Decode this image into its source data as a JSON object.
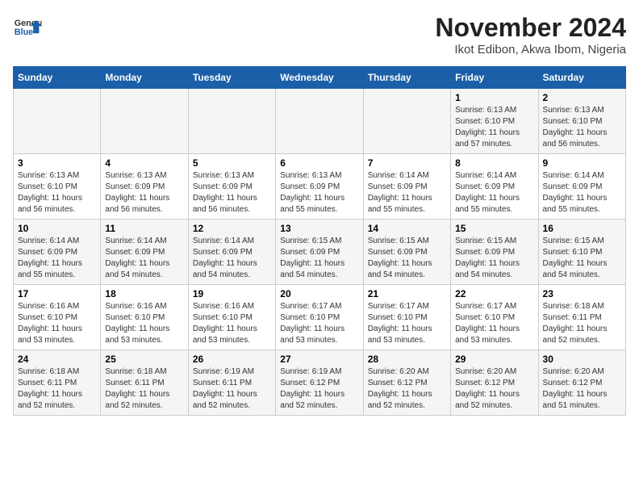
{
  "logo": {
    "general": "General",
    "blue": "Blue"
  },
  "title": "November 2024",
  "subtitle": "Ikot Edibon, Akwa Ibom, Nigeria",
  "headers": [
    "Sunday",
    "Monday",
    "Tuesday",
    "Wednesday",
    "Thursday",
    "Friday",
    "Saturday"
  ],
  "weeks": [
    [
      {
        "day": "",
        "detail": ""
      },
      {
        "day": "",
        "detail": ""
      },
      {
        "day": "",
        "detail": ""
      },
      {
        "day": "",
        "detail": ""
      },
      {
        "day": "",
        "detail": ""
      },
      {
        "day": "1",
        "detail": "Sunrise: 6:13 AM\nSunset: 6:10 PM\nDaylight: 11 hours and 57 minutes."
      },
      {
        "day": "2",
        "detail": "Sunrise: 6:13 AM\nSunset: 6:10 PM\nDaylight: 11 hours and 56 minutes."
      }
    ],
    [
      {
        "day": "3",
        "detail": "Sunrise: 6:13 AM\nSunset: 6:10 PM\nDaylight: 11 hours and 56 minutes."
      },
      {
        "day": "4",
        "detail": "Sunrise: 6:13 AM\nSunset: 6:09 PM\nDaylight: 11 hours and 56 minutes."
      },
      {
        "day": "5",
        "detail": "Sunrise: 6:13 AM\nSunset: 6:09 PM\nDaylight: 11 hours and 56 minutes."
      },
      {
        "day": "6",
        "detail": "Sunrise: 6:13 AM\nSunset: 6:09 PM\nDaylight: 11 hours and 55 minutes."
      },
      {
        "day": "7",
        "detail": "Sunrise: 6:14 AM\nSunset: 6:09 PM\nDaylight: 11 hours and 55 minutes."
      },
      {
        "day": "8",
        "detail": "Sunrise: 6:14 AM\nSunset: 6:09 PM\nDaylight: 11 hours and 55 minutes."
      },
      {
        "day": "9",
        "detail": "Sunrise: 6:14 AM\nSunset: 6:09 PM\nDaylight: 11 hours and 55 minutes."
      }
    ],
    [
      {
        "day": "10",
        "detail": "Sunrise: 6:14 AM\nSunset: 6:09 PM\nDaylight: 11 hours and 55 minutes."
      },
      {
        "day": "11",
        "detail": "Sunrise: 6:14 AM\nSunset: 6:09 PM\nDaylight: 11 hours and 54 minutes."
      },
      {
        "day": "12",
        "detail": "Sunrise: 6:14 AM\nSunset: 6:09 PM\nDaylight: 11 hours and 54 minutes."
      },
      {
        "day": "13",
        "detail": "Sunrise: 6:15 AM\nSunset: 6:09 PM\nDaylight: 11 hours and 54 minutes."
      },
      {
        "day": "14",
        "detail": "Sunrise: 6:15 AM\nSunset: 6:09 PM\nDaylight: 11 hours and 54 minutes."
      },
      {
        "day": "15",
        "detail": "Sunrise: 6:15 AM\nSunset: 6:09 PM\nDaylight: 11 hours and 54 minutes."
      },
      {
        "day": "16",
        "detail": "Sunrise: 6:15 AM\nSunset: 6:10 PM\nDaylight: 11 hours and 54 minutes."
      }
    ],
    [
      {
        "day": "17",
        "detail": "Sunrise: 6:16 AM\nSunset: 6:10 PM\nDaylight: 11 hours and 53 minutes."
      },
      {
        "day": "18",
        "detail": "Sunrise: 6:16 AM\nSunset: 6:10 PM\nDaylight: 11 hours and 53 minutes."
      },
      {
        "day": "19",
        "detail": "Sunrise: 6:16 AM\nSunset: 6:10 PM\nDaylight: 11 hours and 53 minutes."
      },
      {
        "day": "20",
        "detail": "Sunrise: 6:17 AM\nSunset: 6:10 PM\nDaylight: 11 hours and 53 minutes."
      },
      {
        "day": "21",
        "detail": "Sunrise: 6:17 AM\nSunset: 6:10 PM\nDaylight: 11 hours and 53 minutes."
      },
      {
        "day": "22",
        "detail": "Sunrise: 6:17 AM\nSunset: 6:10 PM\nDaylight: 11 hours and 53 minutes."
      },
      {
        "day": "23",
        "detail": "Sunrise: 6:18 AM\nSunset: 6:11 PM\nDaylight: 11 hours and 52 minutes."
      }
    ],
    [
      {
        "day": "24",
        "detail": "Sunrise: 6:18 AM\nSunset: 6:11 PM\nDaylight: 11 hours and 52 minutes."
      },
      {
        "day": "25",
        "detail": "Sunrise: 6:18 AM\nSunset: 6:11 PM\nDaylight: 11 hours and 52 minutes."
      },
      {
        "day": "26",
        "detail": "Sunrise: 6:19 AM\nSunset: 6:11 PM\nDaylight: 11 hours and 52 minutes."
      },
      {
        "day": "27",
        "detail": "Sunrise: 6:19 AM\nSunset: 6:12 PM\nDaylight: 11 hours and 52 minutes."
      },
      {
        "day": "28",
        "detail": "Sunrise: 6:20 AM\nSunset: 6:12 PM\nDaylight: 11 hours and 52 minutes."
      },
      {
        "day": "29",
        "detail": "Sunrise: 6:20 AM\nSunset: 6:12 PM\nDaylight: 11 hours and 52 minutes."
      },
      {
        "day": "30",
        "detail": "Sunrise: 6:20 AM\nSunset: 6:12 PM\nDaylight: 11 hours and 51 minutes."
      }
    ]
  ]
}
